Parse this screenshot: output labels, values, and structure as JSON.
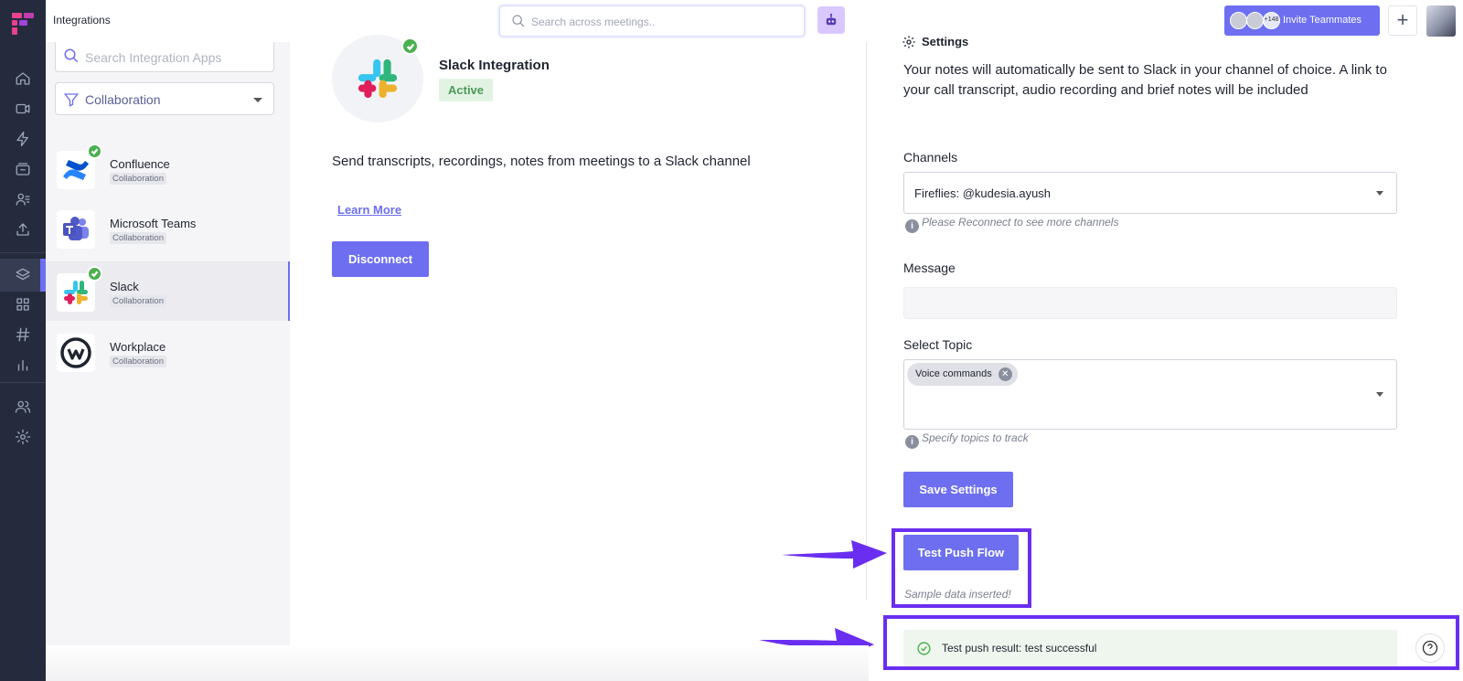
{
  "topbar": {
    "page_title": "Integrations",
    "search_placeholder": "Search across meetings..",
    "invite_count": "+148",
    "invite_label": "Invite Teammates",
    "add_label": "+"
  },
  "sidebar_left": {
    "icons": [
      "home-icon",
      "video-icon",
      "lightning-icon",
      "archive-icon",
      "contacts-icon",
      "upload-icon",
      "layers-icon",
      "apps-grid-icon",
      "hashtag-icon",
      "chart-icon",
      "team-icon",
      "settings-icon"
    ]
  },
  "integrations": {
    "search_placeholder": "Search Integration Apps",
    "filter_value": "Collaboration",
    "apps": [
      {
        "name": "Confluence",
        "category": "Collaboration",
        "connected": true
      },
      {
        "name": "Microsoft Teams",
        "category": "Collaboration",
        "connected": false
      },
      {
        "name": "Slack",
        "category": "Collaboration",
        "connected": true
      },
      {
        "name": "Workplace",
        "category": "Collaboration",
        "connected": false
      }
    ]
  },
  "detail": {
    "title": "Slack Integration",
    "status": "Active",
    "description": "Send transcripts, recordings, notes from meetings to a Slack channel",
    "learn_more": "Learn More",
    "disconnect": "Disconnect"
  },
  "settings": {
    "heading": "Settings",
    "description": "Your notes will automatically be sent to Slack in your channel of choice. A link to your call transcript, audio recording and brief notes will be included",
    "channels_label": "Channels",
    "channels_value": "Fireflies: @kudesia.ayush",
    "channels_hint": "Please Reconnect to see more channels",
    "message_label": "Message",
    "message_value": "",
    "topic_label": "Select Topic",
    "topic_chip": "Voice commands",
    "topic_hint": "Specify topics to track",
    "save_button": "Save Settings",
    "test_button": "Test Push Flow",
    "sample_note": "Sample data inserted!",
    "toast": "Test push result: test successful"
  },
  "colors": {
    "accent": "#6d6ff0",
    "rail": "#252b3d",
    "success": "#4caf50",
    "annotation": "#6a2ef0"
  }
}
